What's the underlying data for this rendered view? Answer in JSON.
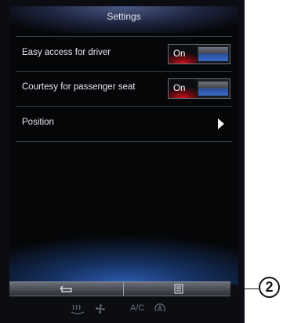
{
  "screen": {
    "title": "Settings"
  },
  "rows": [
    {
      "label": "Easy access for driver",
      "toggle": "On"
    },
    {
      "label": "Courtesy for passenger seat",
      "toggle": "On"
    },
    {
      "label": "Position"
    }
  ],
  "bottom_controls": {
    "ac_label": "A/C"
  },
  "callout": "2",
  "colors": {
    "toggle_on": "#d8141c",
    "toggle_off": "#3c6cc8",
    "background": "#050608"
  },
  "icons": [
    "chevron-right-icon",
    "back-arrow-icon",
    "menu-page-icon",
    "rear-defrost-icon",
    "fan-icon",
    "auto-climate-icon"
  ]
}
